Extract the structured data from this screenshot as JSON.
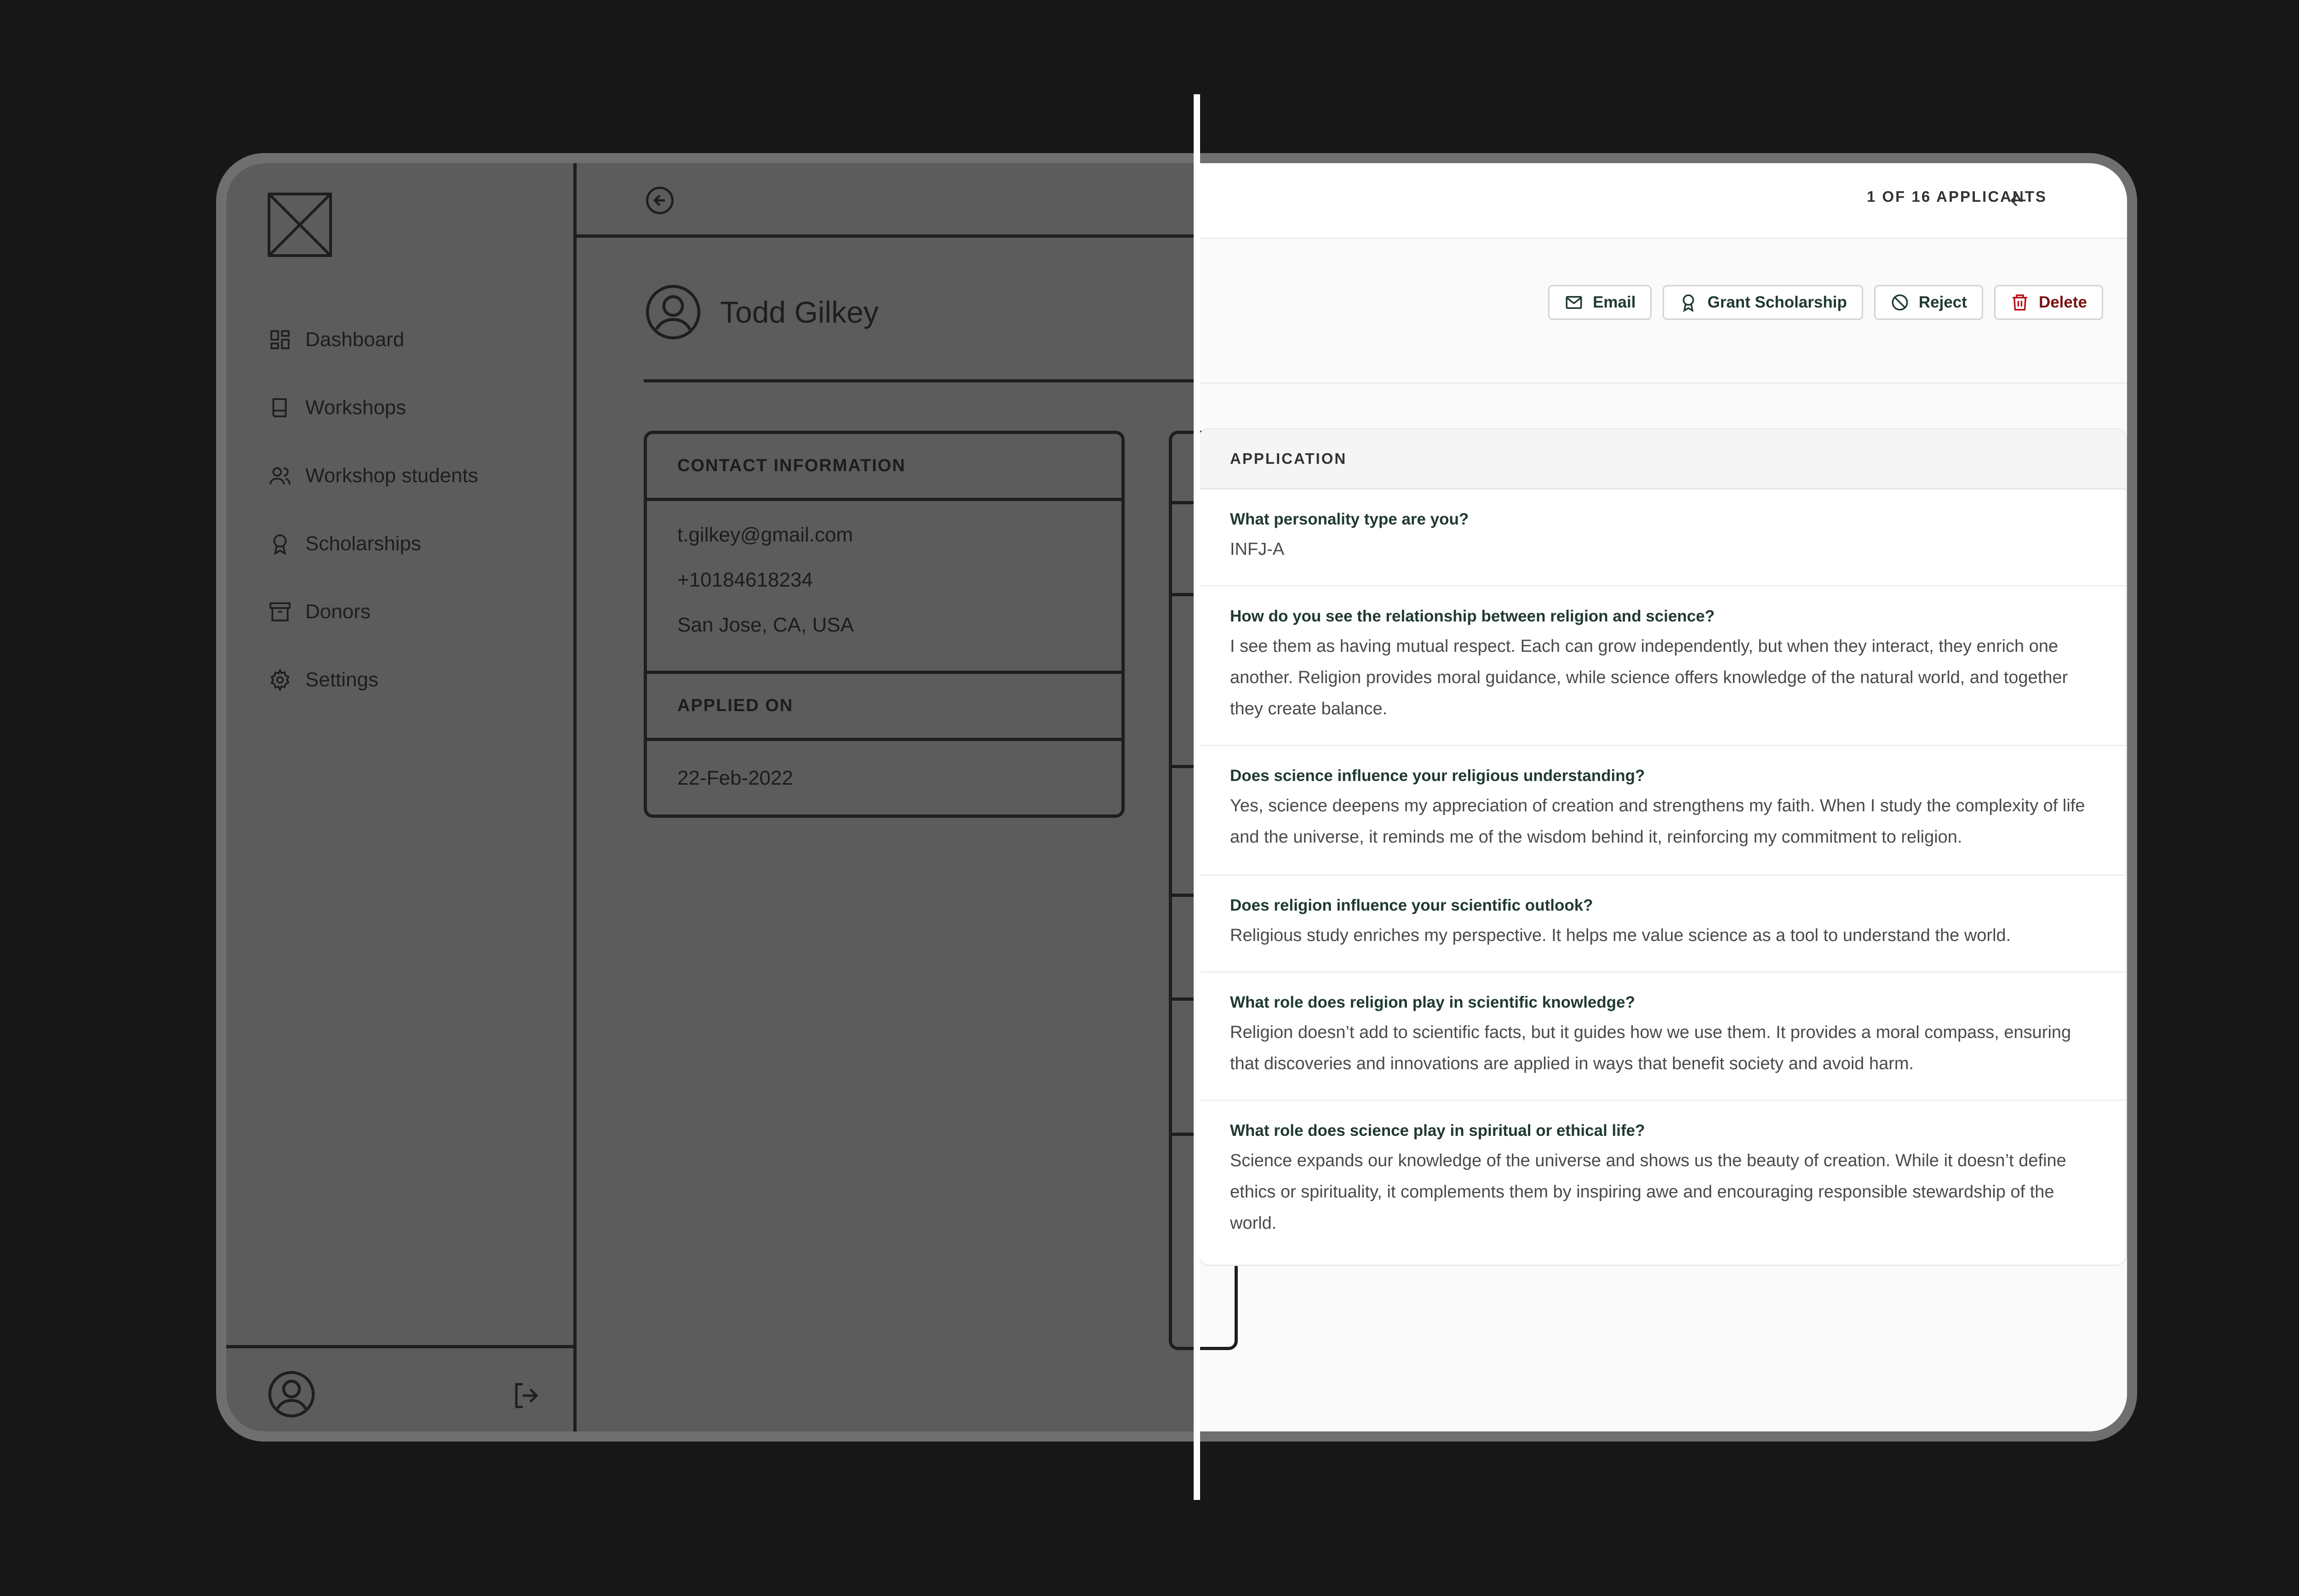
{
  "sidebar": {
    "items": [
      {
        "label": "Dashboard",
        "icon": "grid-icon"
      },
      {
        "label": "Workshops",
        "icon": "book-icon"
      },
      {
        "label": "Workshop students",
        "icon": "users-icon"
      },
      {
        "label": "Scholarships",
        "icon": "award-icon"
      },
      {
        "label": "Donors",
        "icon": "archive-icon"
      },
      {
        "label": "Settings",
        "icon": "gear-icon"
      }
    ]
  },
  "profile": {
    "name": "Todd Gilkey",
    "contact_heading": "CONTACT INFORMATION",
    "email": "t.gilkey@gmail.com",
    "phone": "+10184618234",
    "location": "San Jose, CA, USA",
    "applied_heading": "APPLIED ON",
    "applied_date": "22-Feb-2022"
  },
  "pagination": {
    "label": "1 OF 16 APPLICANTS"
  },
  "actions": {
    "email": "Email",
    "grant": "Grant Scholarship",
    "reject": "Reject",
    "delete": "Delete"
  },
  "colors": {
    "accent_text": "#1f3a2e",
    "danger_text": "#7a1111",
    "backdrop": "#171717"
  },
  "application": {
    "heading": "APPLICATION",
    "qa": [
      {
        "q": "What personality type are you?",
        "a": "INFJ-A"
      },
      {
        "q": "How do you see the relationship between religion and science?",
        "a": "I see them as having mutual respect. Each can grow independently, but when they interact, they enrich one another. Religion provides moral guidance, while science offers knowledge of the natural world, and together they create balance."
      },
      {
        "q": "Does science influence your religious understanding?",
        "a": "Yes, science deepens my appreciation of creation and strengthens my faith. When I study the complexity of life and the universe, it reminds me of the wisdom behind it, reinforcing my commitment to religion."
      },
      {
        "q": "Does religion influence your scientific outlook?",
        "a": "Religious study enriches my perspective. It helps me value science as a tool to understand the world."
      },
      {
        "q": "What role does religion play in scientific knowledge?",
        "a": "Religion doesn’t add to scientific facts, but it guides how we use them. It provides a moral compass, ensuring that discoveries and innovations are applied in ways that benefit society and avoid harm."
      },
      {
        "q": "What role does science play in spiritual or ethical life?",
        "a": "Science expands our knowledge of the universe and shows us the beauty of creation. While it doesn’t define ethics or spirituality, it complements them by inspiring awe and encouraging responsible stewardship of the world."
      }
    ]
  }
}
